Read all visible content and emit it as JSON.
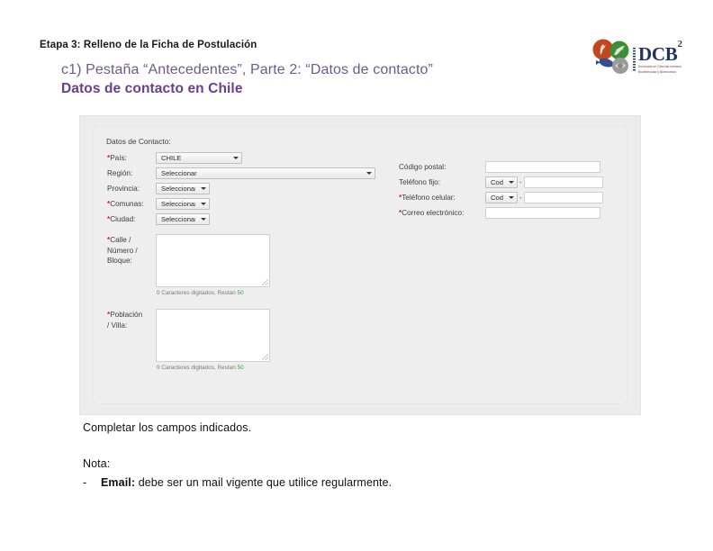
{
  "header": {
    "etapa_title": "Etapa 3: Relleno de la Ficha de Postulación",
    "sub_line_1": "c1) Pestaña “Antecedentes”, Parte 2: “Datos de contacto”",
    "sub_line_2": "Datos de contacto en Chile",
    "accent_purple": "#6b3d8f",
    "accent_purple_light": "#6d5a8c"
  },
  "logo": {
    "name": "DCB",
    "superscript": "2",
    "tagline_line_1": "Doctorado en Ciencias mención",
    "tagline_line_2": "Biodiversidad y Biorecursos",
    "color_text": "#22335e",
    "color_tagline": "#7b2d2d"
  },
  "form": {
    "section_title": "Datos de Contacto:",
    "left": {
      "pais": {
        "label": "País:",
        "required": true,
        "value": "CHILE"
      },
      "region": {
        "label": "Región:",
        "required": false,
        "value": "Seleccionar"
      },
      "provincia": {
        "label": "Provincia:",
        "required": false,
        "value": "Seleccionar"
      },
      "comunas": {
        "label": "Comunas:",
        "required": true,
        "value": "Seleccionar"
      },
      "ciudad": {
        "label": "Ciudad:",
        "required": true,
        "value": "Seleccionar"
      },
      "calle": {
        "label_line_1": "Calle /",
        "label_line_2": "Número /",
        "label_line_3": "Bloque:",
        "required": true,
        "value": "",
        "counter_count": "0",
        "counter_text": " Caracteres digitados, Restan ",
        "counter_remaining": "50"
      },
      "poblacion": {
        "label_line_1": "Población",
        "label_line_2": "/ Villa:",
        "required": true,
        "value": "",
        "counter_count": "0",
        "counter_text": " Caracteres digitados, Restan ",
        "counter_remaining": "50"
      }
    },
    "right": {
      "codigo_postal": {
        "label": "Código postal:",
        "required": false,
        "value": ""
      },
      "telefono_fijo": {
        "label": "Teléfono fijo:",
        "required": false,
        "code_value": "Cod",
        "separator": "-",
        "value": ""
      },
      "telefono_celular": {
        "label": "Teléfono celular:",
        "required": true,
        "code_value": "Cod",
        "separator": "-",
        "value": ""
      },
      "correo": {
        "label": "Correo electrónico:",
        "required": true,
        "value": ""
      }
    },
    "required_marker": "*",
    "required_color": "#cc2b2b",
    "counter_color": "#2e9e3e"
  },
  "notes": {
    "instruction": "Completar los campos indicados.",
    "nota_title": "Nota:",
    "bullet_dash": "-",
    "bullet_bold": "Email:",
    "bullet_rest": " debe ser un mail vigente que utilice regularmente."
  }
}
